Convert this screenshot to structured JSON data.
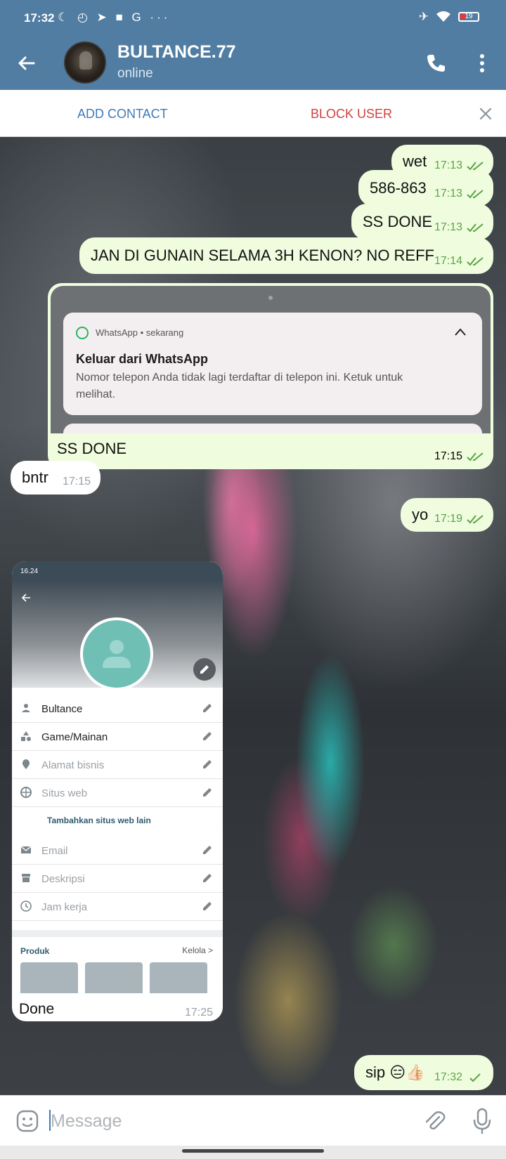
{
  "status_bar": {
    "time": "17:32",
    "icons_text": "☾ ◴ ➤ ■ G ···",
    "battery": "19"
  },
  "header": {
    "title": "BULTANCE.77",
    "subtitle": "online"
  },
  "action_bar": {
    "add_contact": "ADD CONTACT",
    "block_user": "BLOCK USER"
  },
  "messages": [
    {
      "text": "wet",
      "time": "17:13",
      "dir": "out"
    },
    {
      "text": "586-863",
      "time": "17:13",
      "dir": "out"
    },
    {
      "text": "SS DONE",
      "time": "17:13",
      "dir": "out"
    },
    {
      "text": "JAN DI GUNAIN SELAMA 3H KENON? NO REFF",
      "time": "17:14",
      "dir": "out"
    },
    {
      "text": "SS DONE",
      "time": "17:15",
      "dir": "out"
    },
    {
      "text": "bntr",
      "time": "17:15",
      "dir": "in"
    },
    {
      "text": "yo",
      "time": "17:19",
      "dir": "out"
    },
    {
      "text": "Done",
      "time": "17:25",
      "dir": "in"
    },
    {
      "text": "sip 😑👍🏻",
      "time": "17:32",
      "dir": "out"
    }
  ],
  "notification_shot": {
    "app_line": "WhatsApp • sekarang",
    "title": "Keluar dari WhatsApp",
    "body": "Nomor telepon Anda tidak lagi terdaftar di telepon ini. Ketuk untuk melihat."
  },
  "profile_shot": {
    "status_time": "16.24",
    "rows": [
      {
        "label": "Bultance",
        "placeholder": false
      },
      {
        "label": "Game/Mainan",
        "placeholder": false
      },
      {
        "label": "Alamat bisnis",
        "placeholder": true
      },
      {
        "label": "Situs web",
        "placeholder": true
      },
      {
        "label": "Email",
        "placeholder": true
      },
      {
        "label": "Deskripsi",
        "placeholder": true
      },
      {
        "label": "Jam kerja",
        "placeholder": true
      }
    ],
    "add_website": "Tambahkan situs web lain",
    "products_label": "Produk",
    "manage_label": "Kelola >"
  },
  "input": {
    "placeholder": "Message"
  },
  "colors": {
    "header": "#517da2",
    "outgoing_bubble": "#effdde",
    "incoming_bubble": "#ffffff",
    "accent": "#3f7ab8",
    "danger": "#d0413b",
    "tick": "#59a447"
  }
}
